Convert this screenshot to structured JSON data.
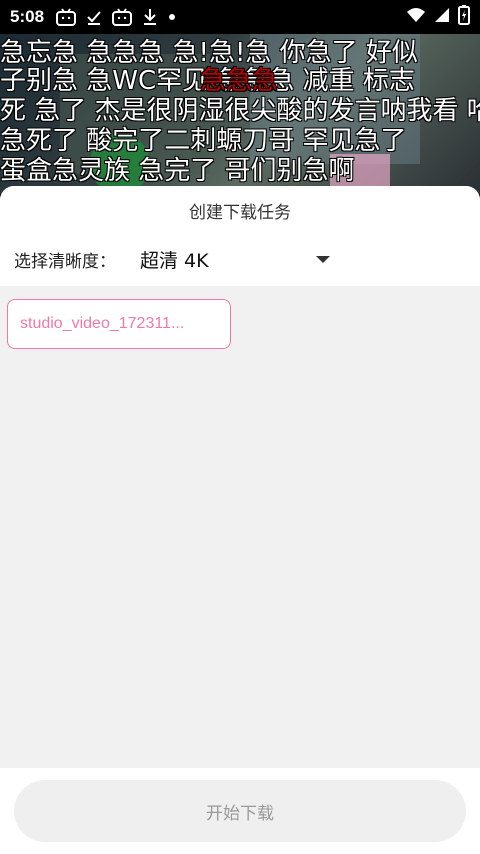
{
  "status_bar": {
    "time": "5:08",
    "icons": [
      "bilibili-tv-icon",
      "check-download-icon",
      "bilibili-tv-icon",
      "download-icon",
      "dot-icon"
    ],
    "right_icons": [
      "wifi-icon",
      "signal-icon",
      "battery-icon"
    ]
  },
  "danmaku": [
    "急忘急 急急急 急!急!急  你急了 好似",
    "子别急  急WC罕见 急急急  减重  标志",
    "死 急了 杰是很阴湿很尖酸的发言呐我看  哈",
    "急死了  酸完了二刺螈刀哥 罕见急了",
    "蛋盒急灵族  急完了  哥们别急啊"
  ],
  "danmaku_highlight": "急急急",
  "sheet": {
    "title": "创建下载任务",
    "quality_label": "选择清晰度：",
    "quality_value": "超清 4K",
    "file_chip": "studio_video_172311...",
    "start_button": "开始下载"
  },
  "colors": {
    "accent_pink": "#f07aa6",
    "danmaku_red": "#c10000"
  }
}
